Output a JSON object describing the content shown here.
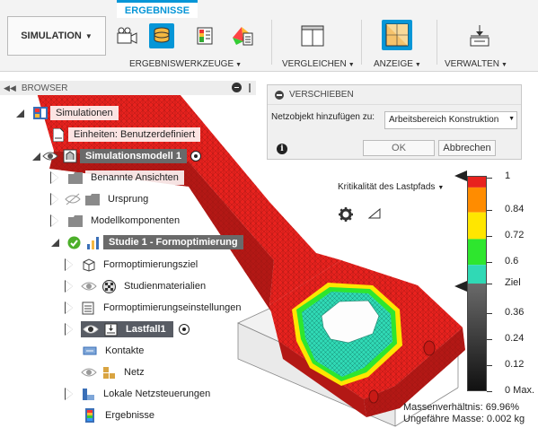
{
  "toolbar": {
    "workspace_label": "SIMULATION",
    "active_tab": "ERGEBNISSE",
    "groups": {
      "results_tools": "ERGEBNISWERKZEUGE",
      "compare": "VERGLEICHEN",
      "display": "ANZEIGE",
      "manage": "VERWALTEN"
    }
  },
  "browser": {
    "title": "BROWSER",
    "tree": [
      {
        "label": "Simulationen"
      },
      {
        "label": "Einheiten: Benutzerdefiniert"
      },
      {
        "label": "Simulationsmodell 1"
      },
      {
        "label": "Benannte Ansichten"
      },
      {
        "label": "Ursprung"
      },
      {
        "label": "Modellkomponenten"
      },
      {
        "label": "Studie 1 - Formoptimierung"
      },
      {
        "label": "Formoptimierungsziel"
      },
      {
        "label": "Studienmaterialien"
      },
      {
        "label": "Formoptimierungseinstellungen"
      },
      {
        "label": "Lastfall1"
      },
      {
        "label": "Kontakte"
      },
      {
        "label": "Netz"
      },
      {
        "label": "Lokale Netzsteuerungen"
      },
      {
        "label": "Ergebnisse"
      }
    ]
  },
  "dialog": {
    "title": "VERSCHIEBEN",
    "field_label": "Netzobjekt hinzufügen zu:",
    "field_value": "Arbeitsbereich Konstruktion",
    "ok_label": "OK",
    "cancel_label": "Abbrechen"
  },
  "legend": {
    "dropdown": "Kritikalität des Lastpfads",
    "labels": [
      "1",
      "0.84",
      "0.72",
      "0.6",
      "Ziel",
      "0.36",
      "0.24",
      "0.12",
      "0 Max."
    ],
    "colors": {
      "red": "#e8221e",
      "orange": "#ff8c00",
      "yellow": "#ffe600",
      "green": "#2ee62e",
      "teal": "#30d9b5"
    }
  },
  "summary": {
    "mass_ratio": "Massenverhältnis: 69.96%",
    "approx_mass": "Ungefähre Masse: 0.002 kg"
  }
}
